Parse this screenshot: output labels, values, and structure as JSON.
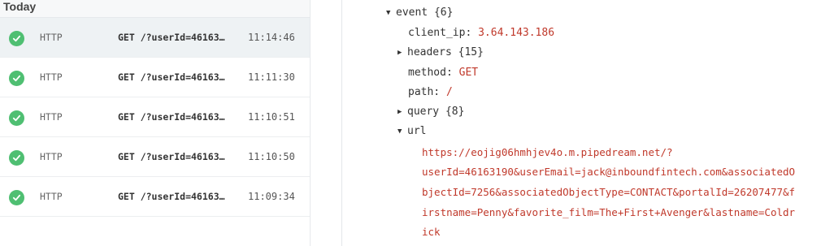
{
  "list": {
    "section_title": "Today",
    "events": [
      {
        "source": "HTTP",
        "request": "GET /?userId=46163…",
        "time": "11:14:46"
      },
      {
        "source": "HTTP",
        "request": "GET /?userId=46163…",
        "time": "11:11:30"
      },
      {
        "source": "HTTP",
        "request": "GET /?userId=46163…",
        "time": "11:10:51"
      },
      {
        "source": "HTTP",
        "request": "GET /?userId=46163…",
        "time": "11:10:50"
      },
      {
        "source": "HTTP",
        "request": "GET /?userId=46163…",
        "time": "11:09:34"
      }
    ]
  },
  "inspector": {
    "event_key": "event",
    "event_count": "{6}",
    "client_ip_key": "client_ip:",
    "client_ip_value": "3.64.143.186",
    "headers_key": "headers",
    "headers_count": "{15}",
    "method_key": "method:",
    "method_value": "GET",
    "path_key": "path:",
    "path_value": "/",
    "query_key": "query",
    "query_count": "{8}",
    "url_key": "url",
    "url_lines": [
      "https://eojig06hmhjev4o.m.pipedream.net/?",
      "userId=46163190&userEmail=jack@inboundfintech.com&associatedO",
      "bjectId=7256&associatedObjectType=CONTACT&portalId=26207477&f",
      "irstname=Penny&favorite_film=The+First+Avenger&lastname=Coldr",
      "ick"
    ]
  },
  "colors": {
    "success": "#4fbf72",
    "string_value": "#c0392b",
    "selected_row": "#eef2f4"
  },
  "icons": {
    "status": "check-circle-icon",
    "expanded": "triangle-down-icon",
    "collapsed": "triangle-right-icon"
  }
}
